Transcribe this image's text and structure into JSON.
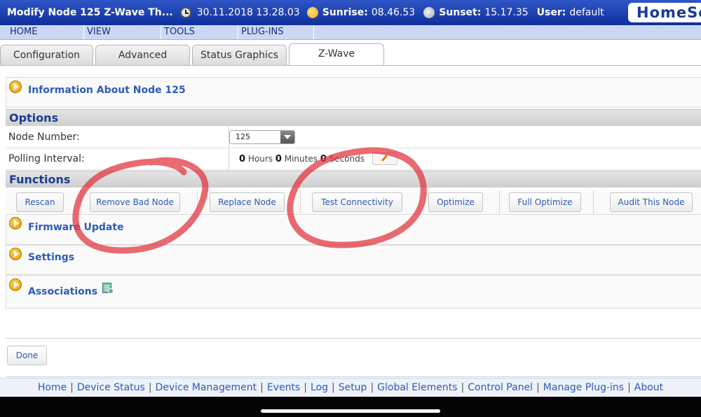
{
  "topbar": {
    "title": "Modify Node 125 Z-Wave Th...",
    "datetime": "30.11.2018 13.28.03",
    "sunrise_label": "Sunrise:",
    "sunrise_value": "08.46.53",
    "sunset_label": "Sunset:",
    "sunset_value": "15.17.35",
    "user_label": "User:",
    "user_value": "default",
    "logo": "HomeSe"
  },
  "menu": {
    "items": [
      {
        "label": "HOME"
      },
      {
        "label": "VIEW"
      },
      {
        "label": "TOOLS"
      },
      {
        "label": "PLUG-INS"
      }
    ]
  },
  "tabs": {
    "items": [
      {
        "label": "Configuration"
      },
      {
        "label": "Advanced"
      },
      {
        "label": "Status Graphics"
      },
      {
        "label": "Z-Wave"
      }
    ],
    "active": "Z-Wave"
  },
  "info": {
    "title": "Information About Node 125"
  },
  "options": {
    "header": "Options",
    "node_number_label": "Node Number:",
    "node_number_value": "125",
    "polling_label": "Polling Interval:",
    "hours_value": "0",
    "hours_label": "Hours",
    "minutes_value": "0",
    "minutes_label": "Minutes",
    "seconds_value": "0",
    "seconds_label": "Seconds"
  },
  "functions": {
    "header": "Functions",
    "buttons": [
      {
        "label": "Rescan"
      },
      {
        "label": "Remove Bad Node"
      },
      {
        "label": "Replace Node"
      },
      {
        "label": "Test Connectivity"
      },
      {
        "label": "Optimize"
      },
      {
        "label": "Full Optimize"
      },
      {
        "label": "Audit This Node"
      }
    ]
  },
  "sections": {
    "firmware": "Firmware Update",
    "settings": "Settings",
    "associations": "Associations"
  },
  "done_label": "Done",
  "footer": {
    "links": [
      {
        "label": "Home"
      },
      {
        "label": "Device Status"
      },
      {
        "label": "Device Management"
      },
      {
        "label": "Events"
      },
      {
        "label": "Log"
      },
      {
        "label": "Setup"
      },
      {
        "label": "Global Elements"
      },
      {
        "label": "Control Panel"
      },
      {
        "label": "Manage Plug-ins"
      },
      {
        "label": "About"
      }
    ]
  },
  "colors": {
    "topbar": "#1f40b0",
    "link": "#2d5bb9",
    "annotation": "#e0303a"
  }
}
